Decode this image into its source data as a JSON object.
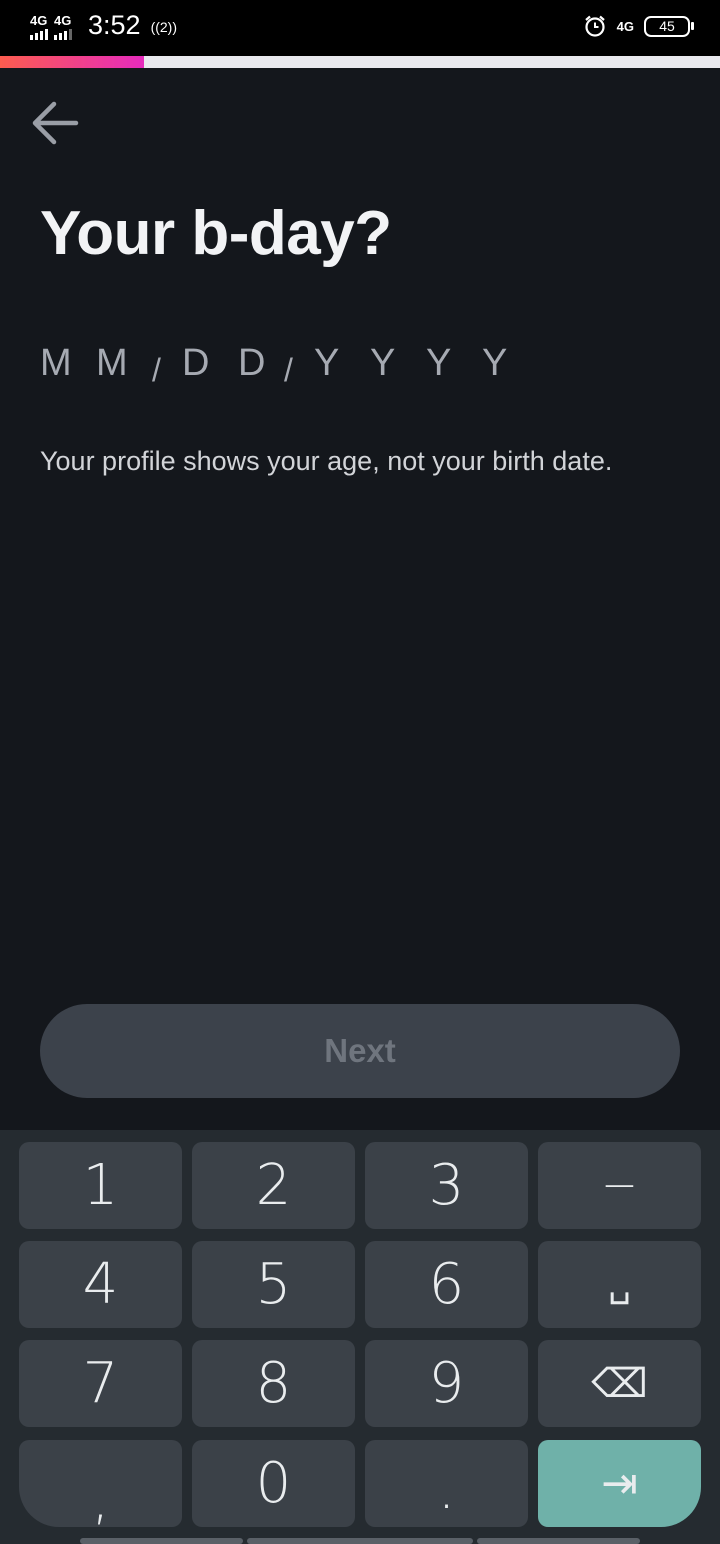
{
  "status_bar": {
    "sim1": "4G",
    "sim2": "4G",
    "time": "3:52",
    "hotspot": "((2))",
    "data_label": "4G",
    "battery": "45"
  },
  "progress": {
    "fraction": 0.2
  },
  "header": {
    "back_icon": "arrow-left-icon"
  },
  "page": {
    "title": "Your b-day?",
    "date_placeholder": {
      "month": [
        "M",
        "M"
      ],
      "day": [
        "D",
        "D"
      ],
      "year": [
        "Y",
        "Y",
        "Y",
        "Y"
      ],
      "separator": "/"
    },
    "hint": "Your profile shows your age, not your birth date.",
    "next_label": "Next"
  },
  "keyboard": {
    "keys": [
      "1",
      "2",
      "3",
      "−",
      "4",
      "5",
      "6",
      "␣",
      "7",
      "8",
      "9",
      "⌫",
      ",",
      "0",
      ".",
      "⇥"
    ]
  },
  "colors": {
    "background": "#14171c",
    "progress_start": "#fd5c4f",
    "progress_end": "#e62bbd",
    "enter_key": "#6fb1a9"
  }
}
